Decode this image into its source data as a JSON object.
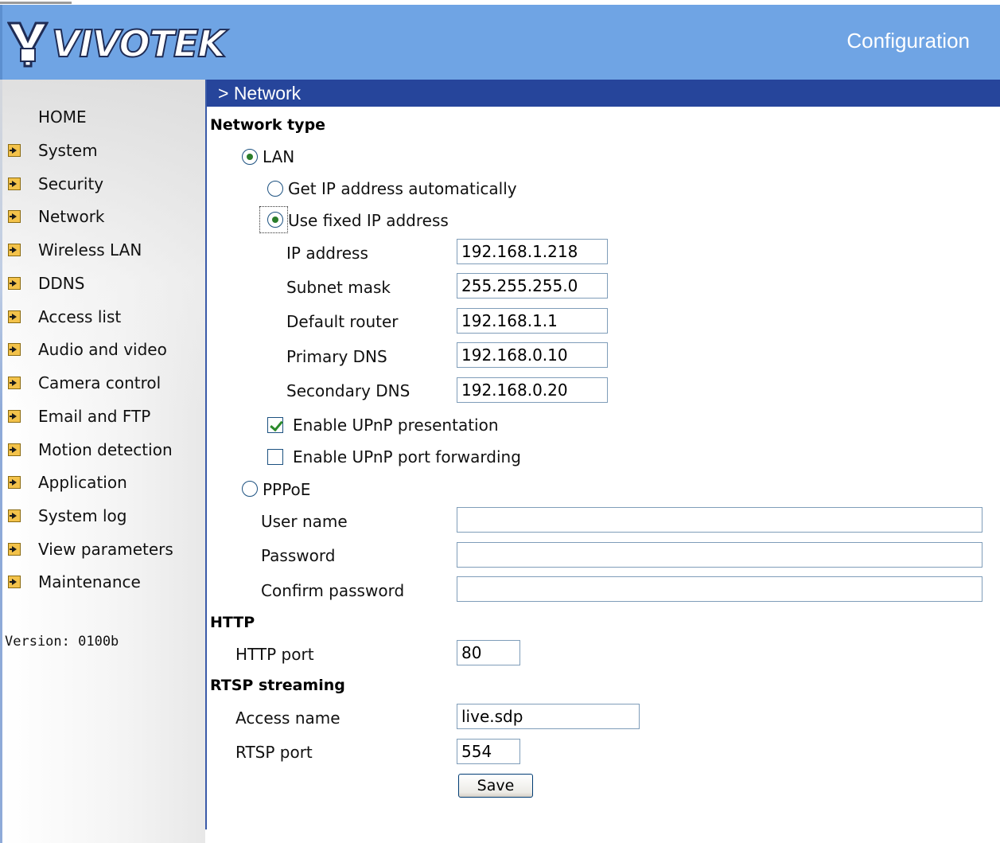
{
  "header": {
    "logo_text": "VIVOTEK",
    "title": "Configuration"
  },
  "sidebar": {
    "home": "HOME",
    "items": [
      {
        "label": "System"
      },
      {
        "label": "Security"
      },
      {
        "label": "Network"
      },
      {
        "label": "Wireless LAN"
      },
      {
        "label": "DDNS"
      },
      {
        "label": "Access list"
      },
      {
        "label": "Audio and video"
      },
      {
        "label": "Camera control"
      },
      {
        "label": "Email and FTP"
      },
      {
        "label": "Motion detection"
      },
      {
        "label": "Application"
      },
      {
        "label": "System log"
      },
      {
        "label": "View parameters"
      },
      {
        "label": "Maintenance"
      }
    ],
    "version": "Version: 0100b"
  },
  "main": {
    "section_title": "> Network",
    "network_type": {
      "heading": "Network type",
      "lan_label": "LAN",
      "lan_selected": true,
      "get_ip_auto_label": "Get IP address automatically",
      "use_fixed_ip_label": "Use fixed IP address",
      "fixed_ip_selected": true,
      "fields": [
        {
          "label": "IP address",
          "value": "192.168.1.218"
        },
        {
          "label": "Subnet mask",
          "value": "255.255.255.0"
        },
        {
          "label": "Default router",
          "value": "192.168.1.1"
        },
        {
          "label": "Primary DNS",
          "value": "192.168.0.10"
        },
        {
          "label": "Secondary DNS",
          "value": "192.168.0.20"
        }
      ],
      "upnp_presentation_label": "Enable UPnP presentation",
      "upnp_presentation_checked": true,
      "upnp_port_forwarding_label": "Enable UPnP port forwarding",
      "upnp_port_forwarding_checked": false,
      "pppoe_label": "PPPoE",
      "pppoe_selected": false,
      "pppoe_fields": [
        {
          "label": "User name",
          "value": ""
        },
        {
          "label": "Password",
          "value": ""
        },
        {
          "label": "Confirm password",
          "value": ""
        }
      ]
    },
    "http": {
      "heading": "HTTP",
      "port_label": "HTTP port",
      "port_value": "80"
    },
    "rtsp": {
      "heading": "RTSP streaming",
      "access_name_label": "Access name",
      "access_name_value": "live.sdp",
      "port_label": "RTSP port",
      "port_value": "554"
    },
    "save_label": "Save"
  }
}
